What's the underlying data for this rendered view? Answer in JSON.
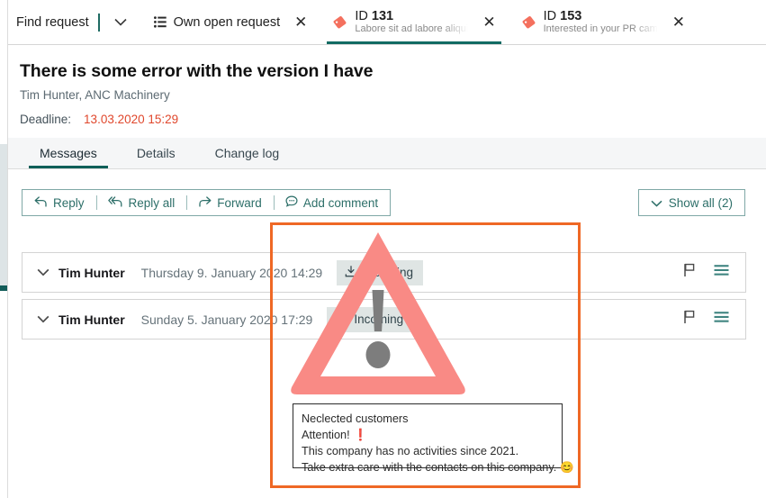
{
  "topbar": {
    "find_request_label": "Find request",
    "caret_icon": "chevron-down-icon",
    "tabs": [
      {
        "id": "own-open-request",
        "icon": "list-icon",
        "label": "Own open request",
        "subtitle": "",
        "close_label": "✕",
        "active": false
      },
      {
        "id": "id-131",
        "icon": "tag-icon",
        "label_prefix": "ID ",
        "label_id": "131",
        "subtitle": "Labore sit ad labore aliqui",
        "close_label": "✕",
        "active": true
      },
      {
        "id": "id-153",
        "icon": "tag-icon",
        "label_prefix": "ID ",
        "label_id": "153",
        "subtitle": "Interested in your PR cam",
        "close_label": "✕",
        "active": false
      }
    ]
  },
  "request": {
    "title": "There is some error with the version I have",
    "contact": "Tim Hunter, ANC Machinery",
    "deadline_label": "Deadline:",
    "deadline_value": "13.03.2020 15:29",
    "deadline_color": "#e0472c"
  },
  "section_tabs": [
    {
      "label": "Messages",
      "active": true
    },
    {
      "label": "Details",
      "active": false
    },
    {
      "label": "Change log",
      "active": false
    }
  ],
  "toolbar": {
    "reply_label": "Reply",
    "reply_all_label": "Reply all",
    "forward_label": "Forward",
    "add_comment_label": "Add comment",
    "show_all_label": "Show all (2)",
    "accent_color": "#2d6f69",
    "border_color": "#7fa8a6"
  },
  "messages": [
    {
      "chevron_icon": "chevron-down-icon",
      "sender": "Tim Hunter",
      "date": "Thursday 9. January 2020 14:29",
      "direction_icon": "download-icon",
      "direction_label": "Incoming",
      "flag_icon": "flag-icon",
      "menu_icon": "list-menu-icon"
    },
    {
      "chevron_icon": "chevron-down-icon",
      "sender": "Tim Hunter",
      "date": "Sunday 5. January 2020 17:29",
      "direction_icon": "download-icon",
      "direction_label": "Incoming",
      "flag_icon": "flag-icon",
      "menu_icon": "list-menu-icon"
    }
  ],
  "annotation": {
    "highlight_color": "#ef6825",
    "warning_icon": "warning-triangle-icon",
    "warning_color": "#f98a85",
    "note": {
      "line1": "Neclected customers",
      "line2": "Attention!",
      "line2_mark": "❗",
      "line3": "This company has no activities since 2021.",
      "line4": "Take extra care with the contacts on this company.",
      "line4_emoji": "😊"
    }
  }
}
